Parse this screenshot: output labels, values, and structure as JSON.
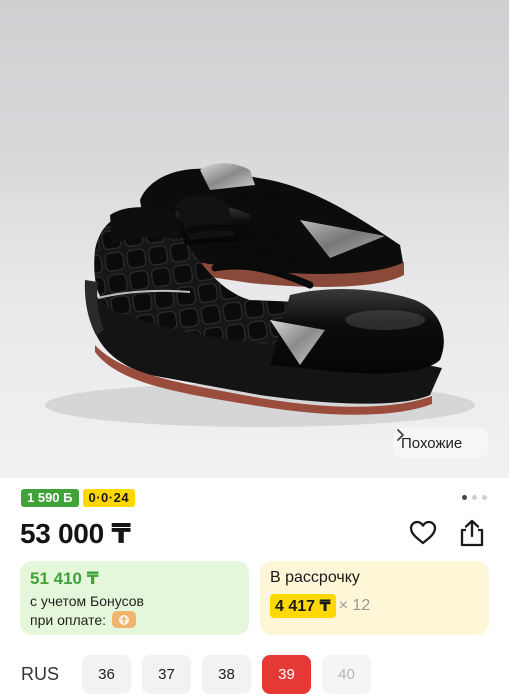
{
  "product": {
    "similar_label": "Похожие",
    "badge_bonus": "1 590 Б",
    "badge_installment": "0·0·24",
    "price": "53 000 ₸",
    "gallery_dots": 3,
    "gallery_active_index": 0
  },
  "bonus_card": {
    "amount": "51 410 ₸",
    "line1": "с учетом Бонусов",
    "line2": "при оплате:"
  },
  "installment_card": {
    "title": "В рассрочку",
    "monthly": "4 417 ₸",
    "months": "× 12"
  },
  "sizes": {
    "system_label": "RUS",
    "options": [
      "36",
      "37",
      "38",
      "39",
      "40"
    ],
    "selected": "39",
    "disabled": [
      "40"
    ]
  },
  "colors": {
    "bonus_green": "#3fa33a",
    "installment_yellow": "#ffd800",
    "selected_red": "#e53935"
  }
}
